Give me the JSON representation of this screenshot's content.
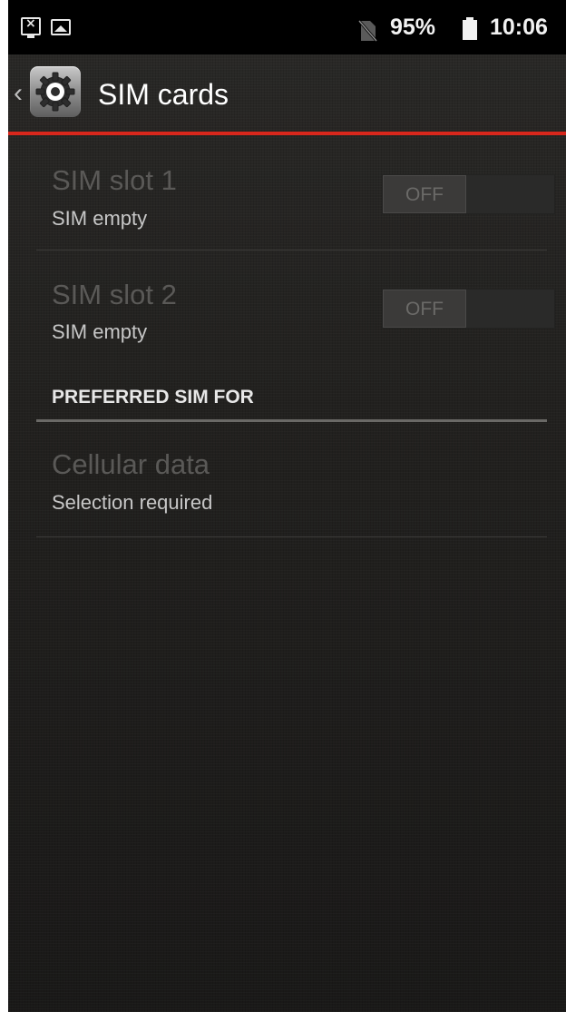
{
  "status_bar": {
    "battery_percent": "95%",
    "time": "10:06",
    "icons": [
      "screen-notification-icon",
      "image-notification-icon",
      "no-sim-icon",
      "battery-icon"
    ]
  },
  "action_bar": {
    "title": "SIM cards",
    "icon": "settings-gear-icon"
  },
  "sim_slots": [
    {
      "title": "SIM slot 1",
      "status": "SIM empty",
      "toggle_label": "OFF"
    },
    {
      "title": "SIM slot 2",
      "status": "SIM empty",
      "toggle_label": "OFF"
    }
  ],
  "preferred_section": {
    "header": "PREFERRED SIM FOR",
    "items": [
      {
        "title": "Cellular data",
        "summary": "Selection required"
      }
    ]
  },
  "colors": {
    "accent_underline": "#d8271c",
    "background": "#22211f",
    "status_bar": "#000000"
  }
}
